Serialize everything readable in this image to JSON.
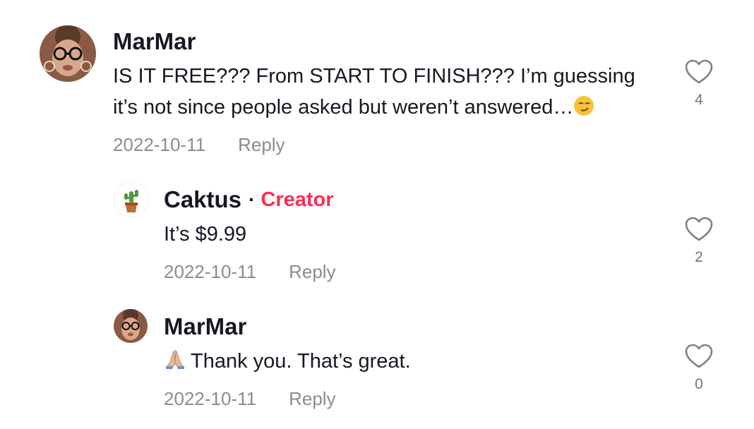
{
  "comments": [
    {
      "username": "MarMar",
      "text_line1": "IS IT FREE??? From START TO FINISH??? I’m guessing",
      "text_line2": "it’s not since people asked but weren’t answered…",
      "emoji": "smirk-emoji",
      "date": "2022-10-11",
      "reply_label": "Reply",
      "like_count": "4"
    },
    {
      "username": "Caktus",
      "separator": "·",
      "badge": "Creator",
      "text": "It’s $9.99",
      "date": "2022-10-11",
      "reply_label": "Reply",
      "like_count": "2"
    },
    {
      "username": "MarMar",
      "emoji": "praying-hands-emoji",
      "text": "Thank you. That’s great.",
      "date": "2022-10-11",
      "reply_label": "Reply",
      "like_count": "0"
    }
  ],
  "colors": {
    "text": "#161823",
    "creator_badge": "#fe2c55",
    "muted": "#8a8b91"
  }
}
